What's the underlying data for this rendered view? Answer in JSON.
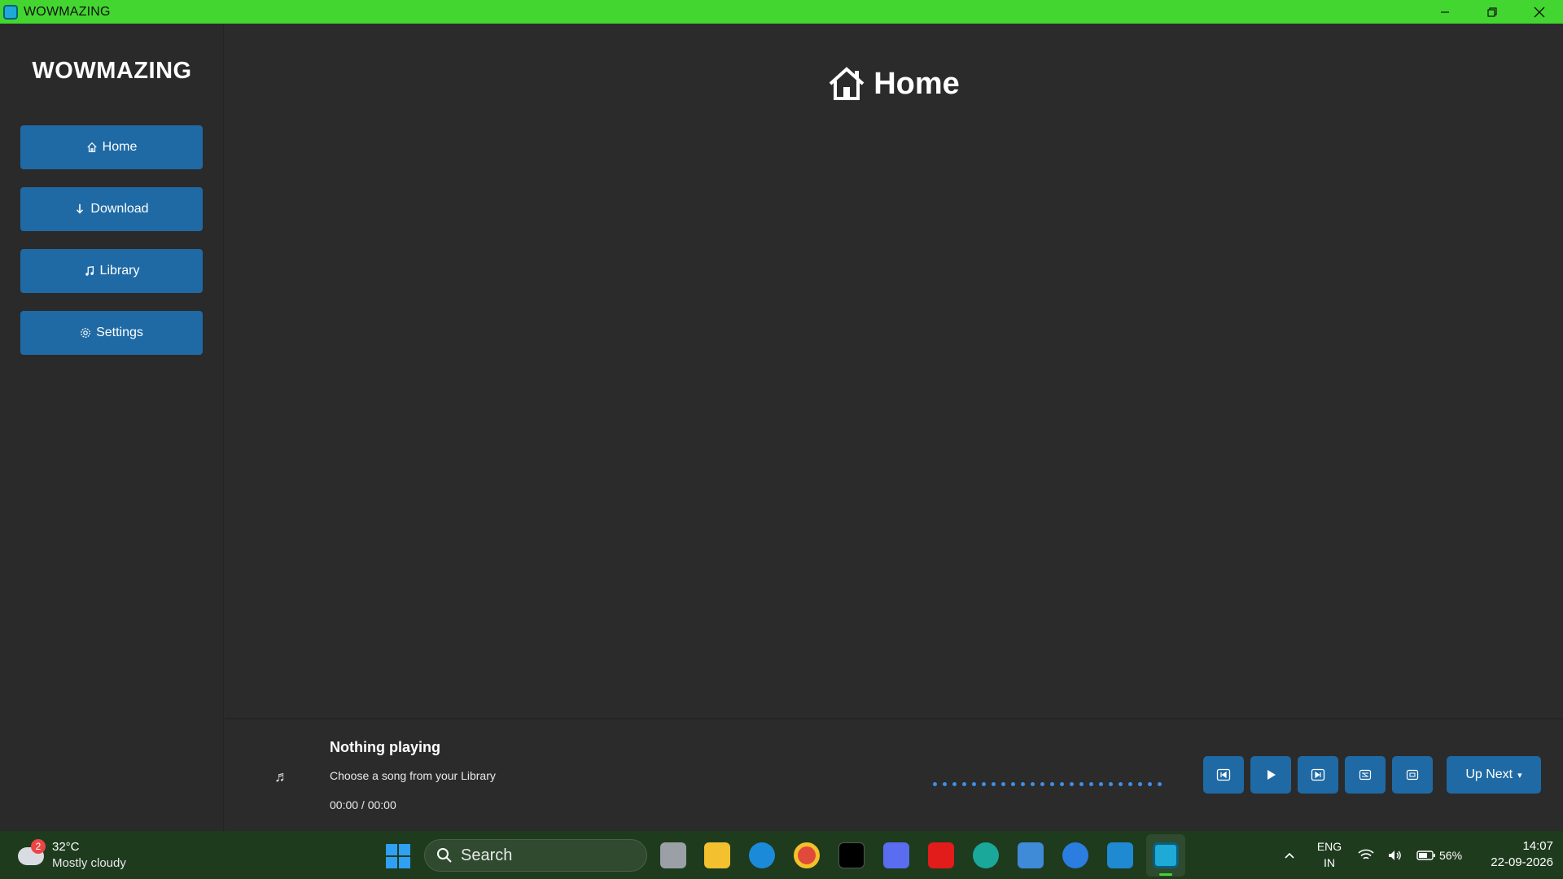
{
  "window": {
    "title": "WOWMAZING",
    "accent": "#43d631"
  },
  "sidebar": {
    "brand": "WOWMAZING",
    "items": [
      {
        "label": "Home",
        "icon": "home-icon"
      },
      {
        "label": "Download",
        "icon": "download-icon"
      },
      {
        "label": "Library",
        "icon": "music-note-icon"
      },
      {
        "label": "Settings",
        "icon": "gear-icon"
      }
    ],
    "button_color": "#1f6aa5"
  },
  "main": {
    "title": "Home",
    "icon": "home-icon"
  },
  "player": {
    "title": "Nothing playing",
    "subtitle": "Choose a song from your Library",
    "time": "00:00 / 00:00",
    "progress": 0,
    "controls": [
      "previous-icon",
      "play-icon",
      "next-icon",
      "shuffle-icon",
      "repeat-icon"
    ],
    "up_next_label": "Up Next",
    "up_next_caret": "▾"
  },
  "taskbar": {
    "weather": {
      "badge": "2",
      "temp": "32°C",
      "condition": "Mostly cloudy"
    },
    "search_label": "Search",
    "tray": {
      "lang_top": "ENG",
      "lang_bottom": "IN",
      "battery": "56%",
      "time": "14:07",
      "date": "22-09-2026"
    }
  }
}
